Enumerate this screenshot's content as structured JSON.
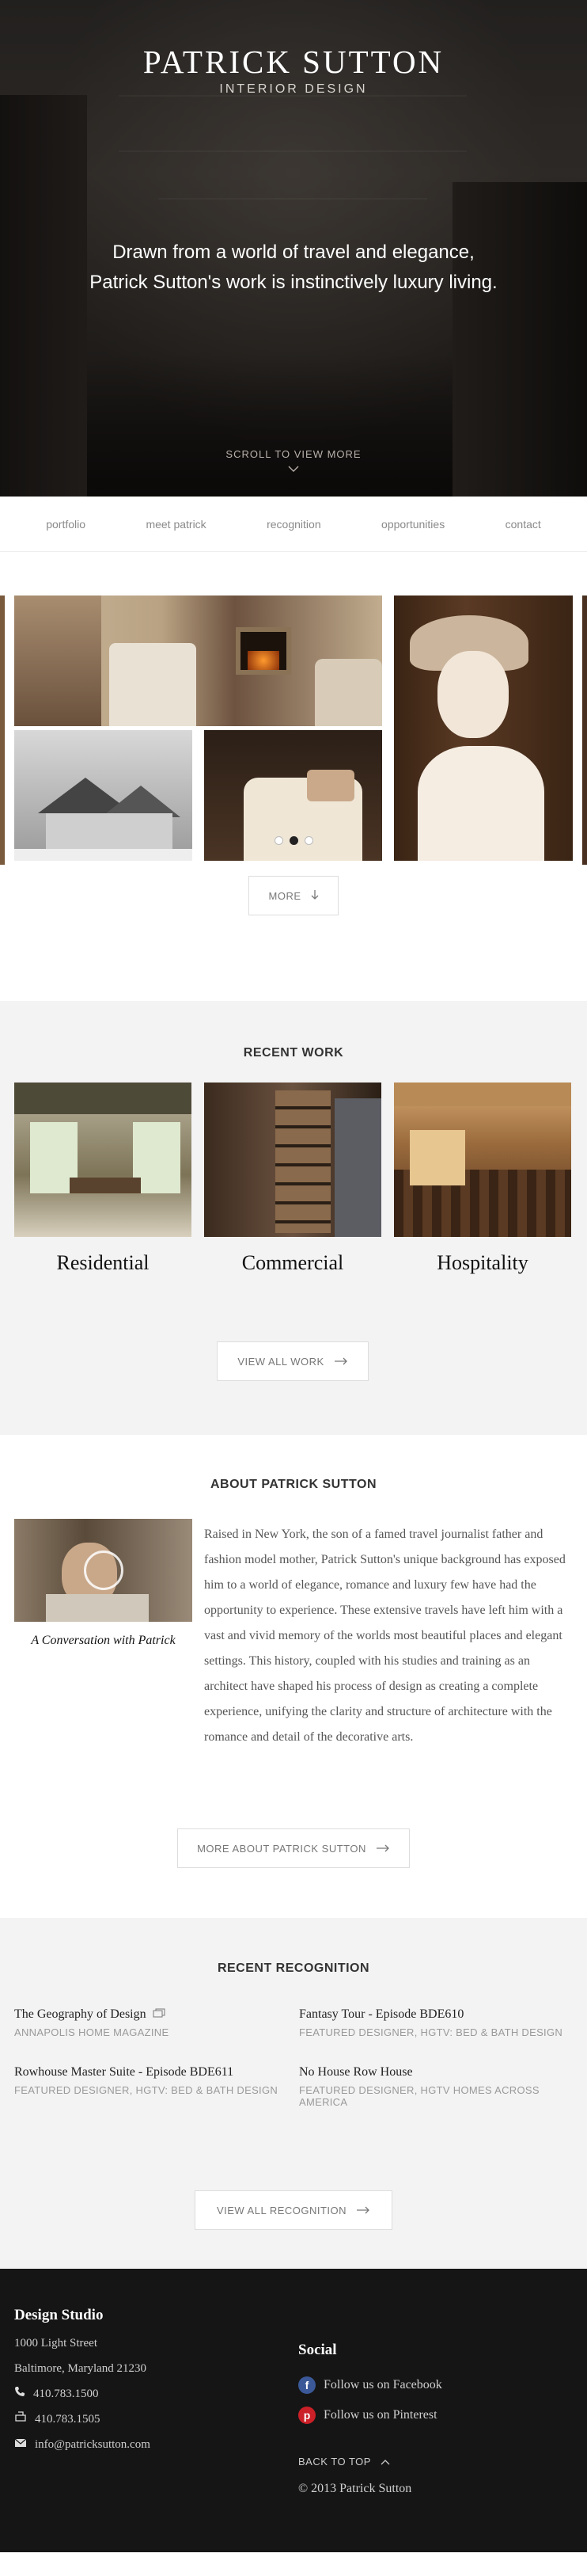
{
  "hero": {
    "brand_name": "PATRICK SUTTON",
    "brand_sub": "INTERIOR DESIGN",
    "tagline_line1": "Drawn from a world of travel and elegance,",
    "tagline_line2": "Patrick Sutton's work is instinctively luxury living.",
    "scroll_label": "SCROLL TO VIEW MORE"
  },
  "nav": {
    "items": [
      "portfolio",
      "meet patrick",
      "recognition",
      "opportunities",
      "contact"
    ]
  },
  "carousel": {
    "more_label": "MORE",
    "slide_count": 3,
    "active_slide": 2
  },
  "recent_work": {
    "title": "RECENT WORK",
    "cards": [
      "Residential",
      "Commercial",
      "Hospitality"
    ],
    "button_label": "VIEW ALL WORK"
  },
  "about": {
    "title": "ABOUT PATRICK SUTTON",
    "caption": "A Conversation with Patrick",
    "body": "Raised in New York, the son of a famed travel journalist father and fashion model mother, Patrick Sutton's unique background has exposed him to a world of elegance, romance and luxury few have had the opportunity to experience. These extensive travels have left him with a vast and vivid memory of the worlds most beautiful places and elegant settings. This history, coupled with his studies and training as an architect have shaped his process of design as creating a complete experience, unifying the clarity and structure of architecture with the romance and detail of the decorative arts.",
    "button_label": "MORE ABOUT PATRICK SUTTON"
  },
  "recognition": {
    "title": "RECENT RECOGNITION",
    "items": [
      {
        "title": "The Geography of Design",
        "source": "ANNAPOLIS HOME MAGAZINE"
      },
      {
        "title": "Fantasy Tour - Episode BDE610",
        "source": "FEATURED DESIGNER, HGTV: BED & BATH DESIGN"
      },
      {
        "title": "Rowhouse Master Suite - Episode BDE611",
        "source": "FEATURED DESIGNER, HGTV: BED & BATH DESIGN"
      },
      {
        "title": "No House Row House",
        "source": "FEATURED DESIGNER, HGTV HOMES ACROSS AMERICA"
      }
    ],
    "button_label": "VIEW ALL RECOGNITION"
  },
  "footer": {
    "studio_title": "Design Studio",
    "address1": "1000 Light Street",
    "address2": "Baltimore, Maryland 21230",
    "phone": "410.783.1500",
    "fax": "410.783.1505",
    "email": "info@patricksutton.com",
    "social_title": "Social",
    "facebook_label": "Follow us on Facebook",
    "pinterest_label": "Follow us on Pinterest",
    "back_to_top": "BACK TO TOP",
    "copyright": "© 2013 Patrick Sutton"
  },
  "colors": {
    "facebook": "#3b5998",
    "pinterest": "#cb2027",
    "footer_bg": "#151515",
    "section_bg": "#f3f3f3"
  }
}
